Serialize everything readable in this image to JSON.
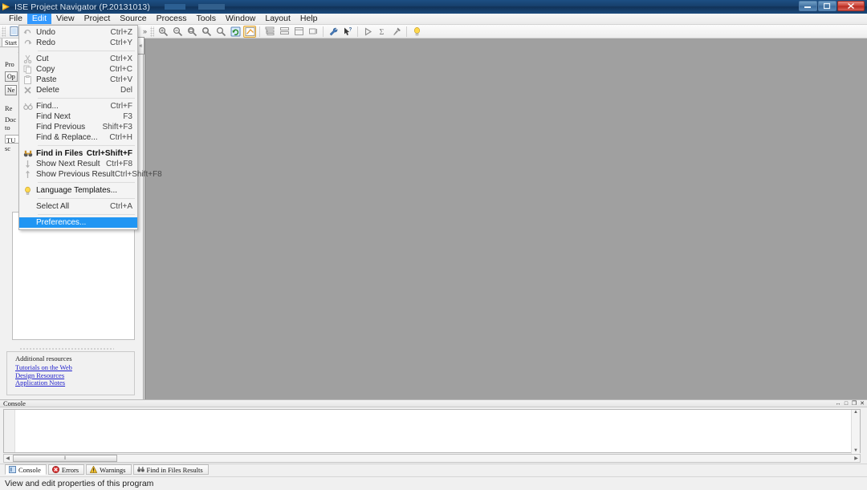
{
  "window": {
    "title": "ISE Project Navigator (P.20131013)",
    "app_icon": "ise-logo-icon",
    "buttons": [
      {
        "name": "minimize-button",
        "glyph": "–"
      },
      {
        "name": "restore-button",
        "glyph": "❐"
      },
      {
        "name": "close-button",
        "glyph": "✕"
      }
    ]
  },
  "menubar": {
    "items": [
      {
        "label": "File",
        "name": "menubar-item-file",
        "active": false
      },
      {
        "label": "Edit",
        "name": "menubar-item-edit",
        "active": true
      },
      {
        "label": "View",
        "name": "menubar-item-view",
        "active": false
      },
      {
        "label": "Project",
        "name": "menubar-item-project",
        "active": false
      },
      {
        "label": "Source",
        "name": "menubar-item-source",
        "active": false
      },
      {
        "label": "Process",
        "name": "menubar-item-process",
        "active": false
      },
      {
        "label": "Tools",
        "name": "menubar-item-tools",
        "active": false
      },
      {
        "label": "Window",
        "name": "menubar-item-window",
        "active": false
      },
      {
        "label": "Layout",
        "name": "menubar-item-layout",
        "active": false
      },
      {
        "label": "Help",
        "name": "menubar-item-help",
        "active": false
      }
    ]
  },
  "edit_menu": {
    "groups": [
      [
        {
          "label": "Undo",
          "accel": "Ctrl+Z",
          "icon": "undo-icon",
          "enabled": false,
          "highlighted": false
        },
        {
          "label": "Redo",
          "accel": "Ctrl+Y",
          "icon": "redo-icon",
          "enabled": false,
          "highlighted": false
        }
      ],
      [
        {
          "label": "Cut",
          "accel": "Ctrl+X",
          "icon": "cut-icon",
          "enabled": false,
          "highlighted": false
        },
        {
          "label": "Copy",
          "accel": "Ctrl+C",
          "icon": "copy-icon",
          "enabled": false,
          "highlighted": false
        },
        {
          "label": "Paste",
          "accel": "Ctrl+V",
          "icon": "paste-icon",
          "enabled": false,
          "highlighted": false
        },
        {
          "label": "Delete",
          "accel": "Del",
          "icon": "delete-icon",
          "enabled": false,
          "highlighted": false
        }
      ],
      [
        {
          "label": "Find...",
          "accel": "Ctrl+F",
          "icon": "find-icon",
          "enabled": false,
          "highlighted": false
        },
        {
          "label": "Find Next",
          "accel": "F3",
          "icon": "",
          "enabled": false,
          "highlighted": false
        },
        {
          "label": "Find Previous",
          "accel": "Shift+F3",
          "icon": "",
          "enabled": false,
          "highlighted": false
        },
        {
          "label": "Find & Replace...",
          "accel": "Ctrl+H",
          "icon": "",
          "enabled": false,
          "highlighted": false
        }
      ],
      [
        {
          "label": "Find in Files",
          "accel": "Ctrl+Shift+F",
          "icon": "find-in-files-icon",
          "enabled": true,
          "bold": true,
          "highlighted": false
        },
        {
          "label": "Show Next Result",
          "accel": "Ctrl+F8",
          "icon": "arrow-down-icon",
          "enabled": false,
          "highlighted": false
        },
        {
          "label": "Show Previous Result",
          "accel": "Ctrl+Shift+F8",
          "icon": "arrow-up-icon",
          "enabled": false,
          "highlighted": false
        }
      ],
      [
        {
          "label": "Language Templates...",
          "accel": "",
          "icon": "lightbulb-icon",
          "enabled": true,
          "bold": true,
          "highlighted": false
        }
      ],
      [
        {
          "label": "Select All",
          "accel": "Ctrl+A",
          "icon": "",
          "enabled": false,
          "highlighted": false
        }
      ],
      [
        {
          "label": "Preferences...",
          "accel": "",
          "icon": "",
          "enabled": true,
          "highlighted": true
        }
      ]
    ]
  },
  "toolbar": {
    "new_file": "new-file-icon",
    "right_groups": [
      [
        "zoom-in-icon",
        "zoom-out-icon",
        "zoom-fit-icon",
        "zoom-region-icon",
        "zoom-select-icon",
        "refresh-icon",
        "highlight-tool-icon"
      ],
      [
        "align-top-icon",
        "align-middle-icon",
        "align-bottom-icon",
        "align-right-icon"
      ],
      [
        "wrench-icon",
        "help-pointer-icon"
      ],
      [
        "run-icon",
        "sum-icon",
        "pin-icon"
      ],
      [
        "lightbulb-icon"
      ]
    ]
  },
  "left_panel": {
    "tab_label": "Start",
    "fragments": [
      "Pro",
      "Op",
      "Ne",
      "Re",
      "Doc",
      "to",
      "TU",
      "sc"
    ],
    "resources": {
      "header": "Additional resources",
      "links": [
        {
          "label": "Tutorials on the Web",
          "name": "link-tutorials-on-the-web"
        },
        {
          "label": "Design Resources",
          "name": "link-design-resources"
        },
        {
          "label": "Application Notes",
          "name": "link-application-notes"
        }
      ]
    },
    "collapse_glyph": "«"
  },
  "console": {
    "title": "Console",
    "window_buttons": [
      {
        "name": "console-float-button",
        "glyph": "↔"
      },
      {
        "name": "console-maximize-button",
        "glyph": "□"
      },
      {
        "name": "console-restore-button",
        "glyph": "❐"
      },
      {
        "name": "console-close-button",
        "glyph": "✕"
      }
    ],
    "content": "",
    "tabs": [
      {
        "label": "Console",
        "name": "console-tab-console",
        "icon": "console-icon",
        "selected": true
      },
      {
        "label": "Errors",
        "name": "console-tab-errors",
        "icon": "error-icon",
        "selected": false
      },
      {
        "label": "Warnings",
        "name": "console-tab-warnings",
        "icon": "warning-icon",
        "selected": false
      },
      {
        "label": "Find in Files Results",
        "name": "console-tab-find-in-files-results",
        "icon": "binoculars-icon",
        "selected": false
      }
    ]
  },
  "statusbar": {
    "text": "View and edit properties of this program"
  },
  "colors": {
    "title_bar": "#17406c",
    "menu_active": "#3399ff",
    "menu_highlight": "#2196f3",
    "workspace": "#a0a0a0",
    "link": "#2222cc",
    "error": "#cc2222",
    "warning": "#e8b020"
  }
}
